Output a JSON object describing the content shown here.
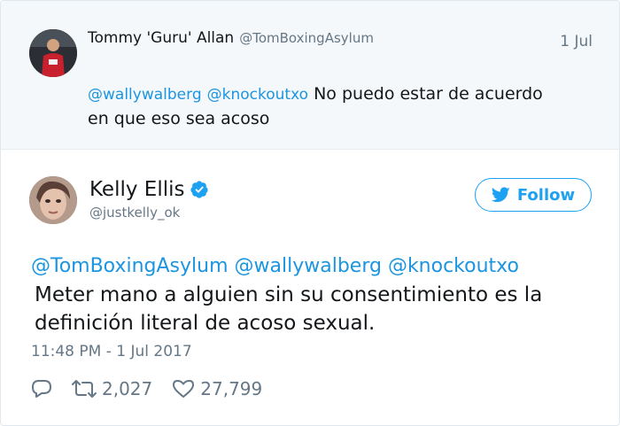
{
  "parent_tweet": {
    "author_name": "Tommy 'Guru' Allan",
    "author_handle": "@TomBoxingAsylum",
    "date": "1 Jul",
    "mention_1": "@wallywalberg",
    "mention_2": "@knockoutxo",
    "text_line_1": "No puedo estar de acuerdo",
    "text_line_2": "en que eso sea acoso"
  },
  "tweet": {
    "author_name": "Kelly Ellis",
    "author_handle": "@justkelly_ok",
    "verified": true,
    "follow_label": "Follow",
    "mentions": "@TomBoxingAsylum @wallywalberg @knockoutxo",
    "text_line_1": "Meter mano a alguien sin su consentimiento es la",
    "text_line_2": "definición literal de acoso sexual.",
    "timestamp": "11:48 PM - 1 Jul 2017",
    "retweets": "2,027",
    "likes": "27,799"
  },
  "icons": {
    "reply": "reply-icon",
    "retweet": "retweet-icon",
    "like": "heart-icon",
    "verified": "verified-badge-icon",
    "follow": "twitter-bird-icon"
  },
  "colors": {
    "link_blue": "#1b95e0",
    "brand_blue": "#1da1f2",
    "secondary_text": "#657786",
    "parent_background": "#f5f8fa"
  }
}
